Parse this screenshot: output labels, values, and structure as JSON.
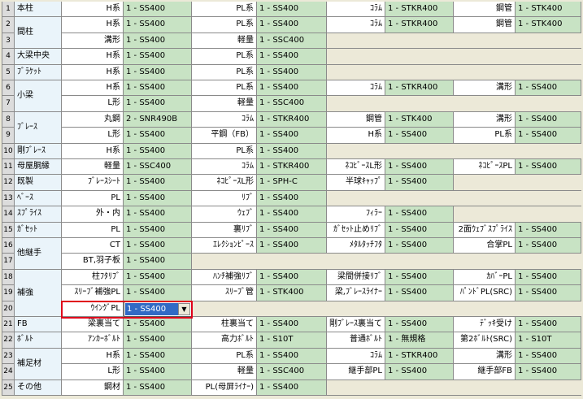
{
  "rows": [
    {
      "no": "1",
      "cat": "本柱",
      "pairs": [
        [
          "H系",
          "1 - SS400"
        ],
        [
          "PL系",
          "1 - SS400"
        ],
        [
          "ｺﾗﾑ",
          "1 - STKR400"
        ],
        [
          "鋼管",
          "1 - STK400"
        ]
      ]
    },
    {
      "no": "2",
      "cat": "間柱",
      "pairs": [
        [
          "H系",
          "1 - SS400"
        ],
        [
          "PL系",
          "1 - SS400"
        ],
        [
          "ｺﾗﾑ",
          "1 - STKR400"
        ],
        [
          "鋼管",
          "1 - STK400"
        ]
      ]
    },
    {
      "no": "3",
      "cat": "",
      "pairs": [
        [
          "溝形",
          "1 - SS400"
        ],
        [
          "軽量",
          "1 - SSC400"
        ]
      ]
    },
    {
      "no": "4",
      "cat": "大梁中央",
      "pairs": [
        [
          "H系",
          "1 - SS400"
        ],
        [
          "PL系",
          "1 - SS400"
        ]
      ]
    },
    {
      "no": "5",
      "cat": "ﾌﾞﾗｹｯﾄ",
      "pairs": [
        [
          "H系",
          "1 - SS400"
        ],
        [
          "PL系",
          "1 - SS400"
        ]
      ]
    },
    {
      "no": "6",
      "cat": "小梁",
      "pairs": [
        [
          "H系",
          "1 - SS400"
        ],
        [
          "PL系",
          "1 - SS400"
        ],
        [
          "ｺﾗﾑ",
          "1 - STKR400"
        ],
        [
          "溝形",
          "1 - SS400"
        ]
      ]
    },
    {
      "no": "7",
      "cat": "",
      "pairs": [
        [
          "L形",
          "1 - SS400"
        ],
        [
          "軽量",
          "1 - SSC400"
        ]
      ]
    },
    {
      "no": "8",
      "cat": "ﾌﾞﾚｰｽ",
      "pairs": [
        [
          "丸鋼",
          "2 - SNR490B"
        ],
        [
          "ｺﾗﾑ",
          "1 - STKR400"
        ],
        [
          "鋼管",
          "1 - STK400"
        ],
        [
          "溝形",
          "1 - SS400"
        ]
      ]
    },
    {
      "no": "9",
      "cat": "",
      "pairs": [
        [
          "L形",
          "1 - SS400"
        ],
        [
          "平鋼（FB）",
          "1 - SS400"
        ],
        [
          "H系",
          "1 - SS400"
        ],
        [
          "PL系",
          "1 - SS400"
        ]
      ]
    },
    {
      "no": "10",
      "cat": "剛ﾌﾞﾚｰｽ",
      "pairs": [
        [
          "H系",
          "1 - SS400"
        ],
        [
          "PL系",
          "1 - SS400"
        ]
      ]
    },
    {
      "no": "11",
      "cat": "母屋胴縁",
      "pairs": [
        [
          "軽量",
          "1 - SSC400"
        ],
        [
          "ｺﾗﾑ",
          "1 - STKR400"
        ],
        [
          "ﾈｺﾋﾟｰｽL形",
          "1 - SS400"
        ],
        [
          "ﾈｺﾋﾟｰｽPL",
          "1 - SS400"
        ]
      ]
    },
    {
      "no": "12",
      "cat": "既製",
      "pairs": [
        [
          "ﾌﾞﾚｰｽｼｰﾄ",
          "1 - SS400"
        ],
        [
          "ﾈｺﾋﾟｰｽL形",
          "1 - SPH-C"
        ],
        [
          "半球ｷｬｯﾌﾟ",
          "1 - SS400"
        ]
      ]
    },
    {
      "no": "13",
      "cat": "ﾍﾞｰｽ",
      "pairs": [
        [
          "PL",
          "1 - SS400"
        ],
        [
          "ﾘﾌﾞ",
          "1 - SS400"
        ]
      ]
    },
    {
      "no": "14",
      "cat": "ｽﾌﾟﾗｲｽ",
      "pairs": [
        [
          "外・内",
          "1 - SS400"
        ],
        [
          "ｳｪﾌﾞ",
          "1 - SS400"
        ],
        [
          "ﾌｨﾗｰ",
          "1 - SS400"
        ]
      ]
    },
    {
      "no": "15",
      "cat": "ｶﾞｾｯﾄ",
      "pairs": [
        [
          "PL",
          "1 - SS400"
        ],
        [
          "裏ﾘﾌﾞ",
          "1 - SS400"
        ],
        [
          "ｶﾞｾｯﾄ止めﾘﾌﾞ",
          "1 - SS400"
        ],
        [
          "2面ｳｪﾌﾞｽﾌﾟﾗｲｽ",
          "1 - SS400"
        ]
      ]
    },
    {
      "no": "16",
      "cat": "他継手",
      "pairs": [
        [
          "CT",
          "1 - SS400"
        ],
        [
          "ｴﾚｸｼｮﾝﾋﾟｰｽ",
          "1 - SS400"
        ],
        [
          "ﾒﾀﾙﾀｯﾁﾌﾀ",
          "1 - SS400"
        ],
        [
          "合掌PL",
          "1 - SS400"
        ]
      ]
    },
    {
      "no": "17",
      "cat": "",
      "pairs": [
        [
          "BT,羽子板",
          "1 - SS400"
        ]
      ]
    },
    {
      "no": "18",
      "cat": "補強",
      "pairs": [
        [
          "柱ﾌﾀﾘﾌﾞ",
          "1 - SS400"
        ],
        [
          "ﾊﾝﾁ補強ﾘﾌﾞ",
          "1 - SS400"
        ],
        [
          "梁間併接ﾘﾌﾞ",
          "1 - SS400"
        ],
        [
          "ｶﾊﾞｰPL",
          "1 - SS400"
        ]
      ]
    },
    {
      "no": "19",
      "cat": "",
      "pairs": [
        [
          "ｽﾘｰﾌﾞ補強PL",
          "1 - SS400"
        ],
        [
          "ｽﾘｰﾌﾞ管",
          "1 - STK400"
        ],
        [
          "梁,ﾌﾞﾚｰｽﾗｲﾅｰ",
          "1 - SS400"
        ],
        [
          "ﾊﾟﾝﾄﾞPL(SRC)",
          "1 - SS400"
        ]
      ]
    },
    {
      "no": "20",
      "cat": "",
      "pairs": [
        [
          "ｳｲﾝｸﾞPL",
          "1 - SS400"
        ]
      ]
    },
    {
      "no": "21",
      "cat": "FB",
      "pairs": [
        [
          "梁裏当て",
          "1 - SS400"
        ],
        [
          "柱裏当て",
          "1 - SS400"
        ],
        [
          "剛ﾌﾞﾚｰｽ裏当て",
          "1 - SS400"
        ],
        [
          "ﾃﾞｯｷ受け",
          "1 - SS400"
        ]
      ]
    },
    {
      "no": "22",
      "cat": "ﾎﾞﾙﾄ",
      "pairs": [
        [
          "ｱﾝｶｰﾎﾞﾙﾄ",
          "1 - SS400"
        ],
        [
          "高力ﾎﾞﾙﾄ",
          "1 - S10T"
        ],
        [
          "普通ﾎﾞﾙﾄ",
          "1 - 無規格"
        ],
        [
          "第2ﾎﾞﾙﾄ(SRC)",
          "1 - S10T"
        ]
      ]
    },
    {
      "no": "23",
      "cat": "補足材",
      "pairs": [
        [
          "H系",
          "1 - SS400"
        ],
        [
          "PL系",
          "1 - SS400"
        ],
        [
          "ｺﾗﾑ",
          "1 - STKR400"
        ],
        [
          "溝形",
          "1 - SS400"
        ]
      ]
    },
    {
      "no": "24",
      "cat": "",
      "pairs": [
        [
          "L形",
          "1 - SS400"
        ],
        [
          "軽量",
          "1 - SSC400"
        ],
        [
          "継手部PL",
          "1 - SS400"
        ],
        [
          "継手部FB",
          "1 - SS400"
        ]
      ]
    },
    {
      "no": "25",
      "cat": "その他",
      "pairs": [
        [
          "鋼材",
          "1 - SS400"
        ],
        [
          "PL(母屏ﾗｲﾅｰ)",
          "1 - SS400"
        ]
      ]
    }
  ],
  "merged_categories": [
    {
      "rows": [
        2,
        3
      ],
      "text": "間柱"
    },
    {
      "rows": [
        6,
        7
      ],
      "text": "小梁"
    },
    {
      "rows": [
        8,
        9
      ],
      "text": "ﾌﾞﾚｰｽ"
    },
    {
      "rows": [
        16,
        17
      ],
      "text": "他継手"
    },
    {
      "rows": [
        18,
        20
      ],
      "text": "補強"
    },
    {
      "rows": [
        23,
        24
      ],
      "text": "補足材"
    }
  ],
  "active_dropdown": {
    "row": "20",
    "label": "ｳｲﾝｸﾞPL",
    "value": "1 - SS400",
    "button_glyph": "▼"
  }
}
